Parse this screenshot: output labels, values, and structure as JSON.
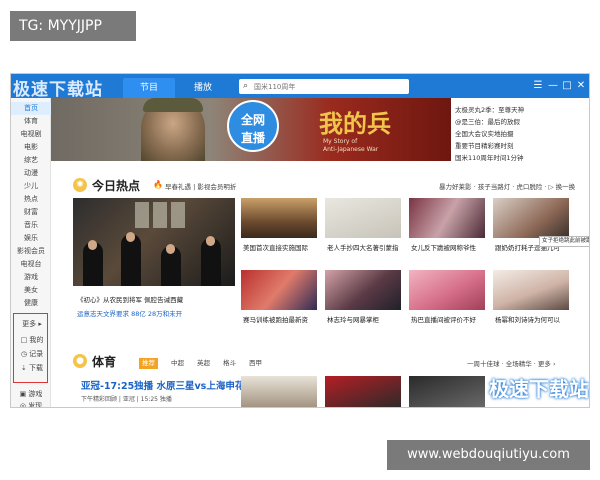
{
  "watermarks": {
    "top": "TG: MYYJJPP",
    "bottom": "www.webdouqiutiyu.com",
    "app": "极速下载站"
  },
  "titlebar": {
    "logo": "极速下载站",
    "tabs": [
      {
        "label": "节目",
        "active": true
      },
      {
        "label": "播放",
        "active": false
      }
    ],
    "search_placeholder": "国米110周年",
    "window_buttons": [
      {
        "icon": "menu-icon",
        "glyph": "☰"
      },
      {
        "icon": "minimize-icon",
        "glyph": "—"
      },
      {
        "icon": "maximize-icon",
        "glyph": "□"
      },
      {
        "icon": "close-icon",
        "glyph": "✕"
      }
    ]
  },
  "sidebar": {
    "items": [
      {
        "label": "首页",
        "active": true
      },
      {
        "label": "体育"
      },
      {
        "label": "电视剧"
      },
      {
        "label": "电影"
      },
      {
        "label": "综艺"
      },
      {
        "label": "动漫"
      },
      {
        "label": "少儿"
      },
      {
        "label": "热点"
      },
      {
        "label": "财富"
      },
      {
        "label": "音乐"
      },
      {
        "label": "娱乐"
      },
      {
        "label": "影视会员"
      },
      {
        "label": "电视台"
      },
      {
        "label": "游戏"
      },
      {
        "label": "美女"
      },
      {
        "label": "健康"
      }
    ],
    "more": "更多 ▸",
    "box_items": [
      {
        "label": "我的",
        "icon": "user-icon",
        "glyph": "□"
      },
      {
        "label": "记录",
        "icon": "clock-icon",
        "glyph": "◷"
      },
      {
        "label": "下载",
        "icon": "download-icon",
        "glyph": "⇣"
      }
    ],
    "bottom_items": [
      {
        "label": "游戏",
        "icon": "gamepad-icon",
        "glyph": "▣"
      },
      {
        "label": "发现",
        "icon": "compass-icon",
        "glyph": "◎"
      }
    ]
  },
  "banner": {
    "badge_line1": "全网",
    "badge_line2": "直播",
    "title": "我的兵",
    "subtitle_1": "My Story of",
    "subtitle_2": "Anti-Japanese War"
  },
  "right_list": [
    "太极灵丸2季：至尊天神",
    "@是三伯：最后的放假",
    "全国大会议实地拍摄",
    "重要节目精彩赛时刻",
    "国米110周年时间1分钟"
  ],
  "hot": {
    "title": "今日热点",
    "fire": "🔥",
    "note": "早春礼遇 | 影视会员明折",
    "right_links": "暴力好莱影 · 孩子当路灯 · 虎口脱险 · ▷ 换一换",
    "big_caption_1": "《初心》从农民到将军 佩腔告诫西藏",
    "big_caption_2": "运意志天文界要求 88亿 28万和未开",
    "thumbs_row1": [
      {
        "caption": "美国首次直接实施国际"
      },
      {
        "caption": "老人手抄四大名著引蒙指"
      },
      {
        "caption": "女儿反下跪被网称爷性"
      },
      {
        "caption": "跟奶奶打耗子逗猫儿可"
      }
    ],
    "thumbs_row2": [
      {
        "caption": "赛马训练被跑拍最新资"
      },
      {
        "caption": "林志玲与网暴掌柜"
      },
      {
        "caption": "热巴直播间被评价不好"
      },
      {
        "caption": "杨幂和刘诗诗为何可以"
      }
    ],
    "tag_overlay": "女子拒绝跳此前被跟踪男子"
  },
  "sports": {
    "title": "体育",
    "tabs": [
      {
        "label": "推荐",
        "active": true
      },
      {
        "label": "中超"
      },
      {
        "label": "英超"
      },
      {
        "label": "格斗"
      },
      {
        "label": "西甲"
      }
    ],
    "right_links": "一周十佳球 · 全场精华 · 更多 ›",
    "banner_title": "亚冠-17:25独播 水原三星vs上海申花",
    "banner_sub": "下午精彩回顾 | 亚冠 | 15:25 独播"
  },
  "colors": {
    "accent": "#1f7ad6",
    "hot_orange": "#f3a323",
    "sports_blue": "#1b63c6",
    "red_box": "#e03434"
  }
}
